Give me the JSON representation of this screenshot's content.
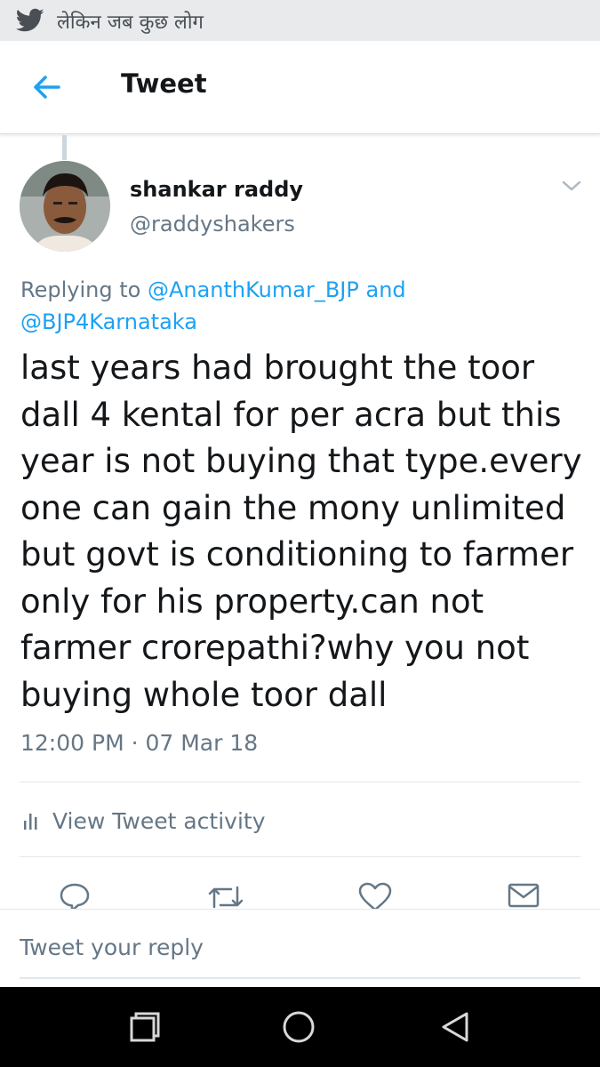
{
  "notification": {
    "app_icon": "twitter-bird-icon",
    "text": "लेकिन जब कुछ लोग"
  },
  "header": {
    "back_icon": "arrow-left-icon",
    "title": "Tweet"
  },
  "tweet": {
    "author": {
      "name": "shankar raddy",
      "handle": "@raddyshakers",
      "avatar": "avatar-photo"
    },
    "replying_to": {
      "prefix": "Replying to",
      "mention_1": "@AnanthKumar_BJP",
      "conjunction": "and",
      "mention_2": "@BJP4Karnataka"
    },
    "text": "last years had brought the toor dall 4 kental for per acra but this year is not buying that type.every one can gain the mony unlimited but govt is conditioning to farmer only for his property.can not farmer crorepathi?why you not buying whole toor dall",
    "timestamp": "12:00 PM · 07 Mar 18",
    "activity_label": "View Tweet activity"
  },
  "actions": {
    "icons": [
      "reply-icon",
      "retweet-icon",
      "like-icon",
      "direct-message-icon"
    ]
  },
  "reply_box": {
    "placeholder": "Tweet your reply"
  },
  "system_nav": {
    "icons": [
      "recent-apps-icon",
      "home-icon",
      "back-triangle-icon"
    ]
  },
  "colors": {
    "accent": "#1da1f2",
    "secondary_text": "#657786",
    "primary_text": "#14171a"
  }
}
